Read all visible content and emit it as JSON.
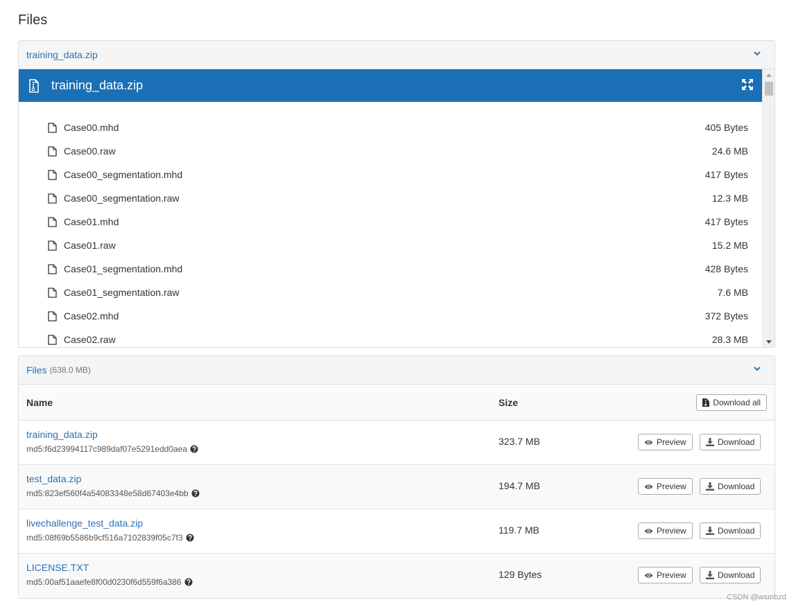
{
  "page": {
    "heading": "Files"
  },
  "preview_panel": {
    "header_title": "training_data.zip",
    "banner_title": "training_data.zip",
    "files": [
      {
        "name": "Case00.mhd",
        "size": "405 Bytes"
      },
      {
        "name": "Case00.raw",
        "size": "24.6 MB"
      },
      {
        "name": "Case00_segmentation.mhd",
        "size": "417 Bytes"
      },
      {
        "name": "Case00_segmentation.raw",
        "size": "12.3 MB"
      },
      {
        "name": "Case01.mhd",
        "size": "417 Bytes"
      },
      {
        "name": "Case01.raw",
        "size": "15.2 MB"
      },
      {
        "name": "Case01_segmentation.mhd",
        "size": "428 Bytes"
      },
      {
        "name": "Case01_segmentation.raw",
        "size": "7.6 MB"
      },
      {
        "name": "Case02.mhd",
        "size": "372 Bytes"
      },
      {
        "name": "Case02.raw",
        "size": "28.3 MB"
      }
    ]
  },
  "files_panel": {
    "title": "Files",
    "total": "(638.0 MB)",
    "col_name": "Name",
    "col_size": "Size",
    "download_all_label": "Download all",
    "preview_label": "Preview",
    "download_label": "Download",
    "rows": [
      {
        "name": "training_data.zip",
        "md5": "md5:f6d23994117c989daf07e5291edd0aea",
        "size": "323.7 MB"
      },
      {
        "name": "test_data.zip",
        "md5": "md5:823ef560f4a54083348e58d67403e4bb",
        "size": "194.7 MB"
      },
      {
        "name": "livechallenge_test_data.zip",
        "md5": "md5:08f69b5586b9cf516a7102839f05c7f3",
        "size": "119.7 MB"
      },
      {
        "name": "LICENSE.TXT",
        "md5": "md5:00af51aaefe8f00d0230f6d559f6a386",
        "size": "129 Bytes"
      }
    ]
  },
  "watermark": "CSDN @wsmbzd",
  "colors": {
    "link": "#2a72b5",
    "banner": "#1a6fb5"
  }
}
